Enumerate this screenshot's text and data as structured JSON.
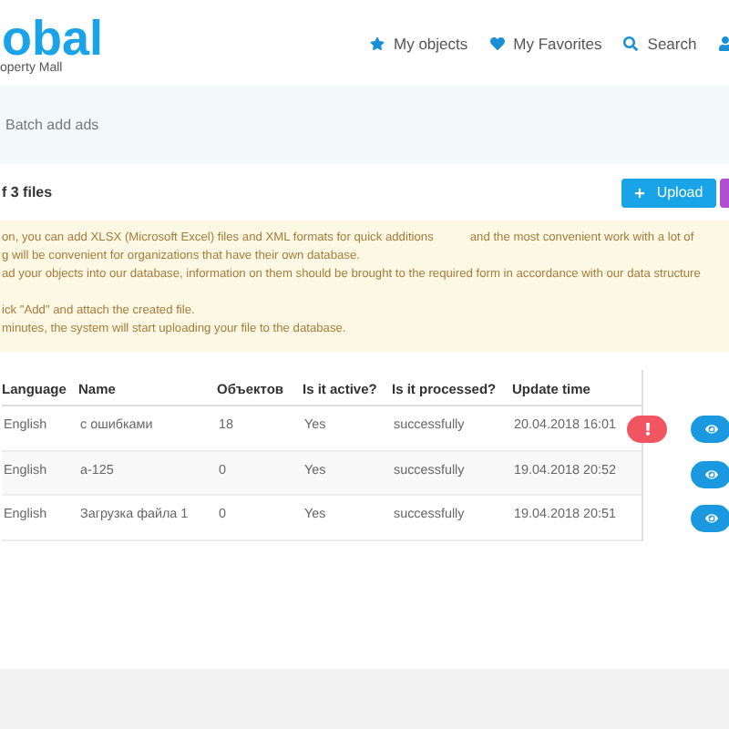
{
  "logo": {
    "title": "obal",
    "subtitle": "operty Mall"
  },
  "nav": [
    {
      "kind": "star",
      "label": "My objects"
    },
    {
      "kind": "heart",
      "label": "My Favorites"
    },
    {
      "kind": "search",
      "label": "Search"
    },
    {
      "kind": "user"
    }
  ],
  "breadcrumb": "Batch add ads",
  "files_title": "f 3 files",
  "upload_button": "Upload",
  "notice": {
    "lines": [
      [
        "on, you can add XLSX (Microsoft Excel) files and XML formats for quick additions",
        "and the most convenient work with a lot of"
      ],
      [
        "g will be convenient for organizations that have their own database."
      ],
      [
        "ad your objects into our database, information on them should be brought to the required form in accordance with our data structure"
      ],
      [
        "ick \"Add\" and attach the created file."
      ],
      [
        "minutes, the system will start uploading your file to the database."
      ]
    ]
  },
  "table": {
    "columns": [
      "Language",
      "Name",
      "Объектов",
      "Is it active?",
      "Is it processed?",
      "Update time"
    ],
    "rows": [
      {
        "cells": [
          "English",
          "с ошибками",
          "18",
          "Yes",
          "successfully",
          "20.04.2018 16:01"
        ],
        "has_error": true
      },
      {
        "cells": [
          "English",
          "a-125",
          "0",
          "Yes",
          "successfully",
          "19.04.2018 20:52"
        ],
        "has_error": false
      },
      {
        "cells": [
          "English",
          "Загрузка файла 1",
          "0",
          "Yes",
          "successfully",
          "19.04.2018 20:51"
        ],
        "has_error": false
      }
    ]
  }
}
